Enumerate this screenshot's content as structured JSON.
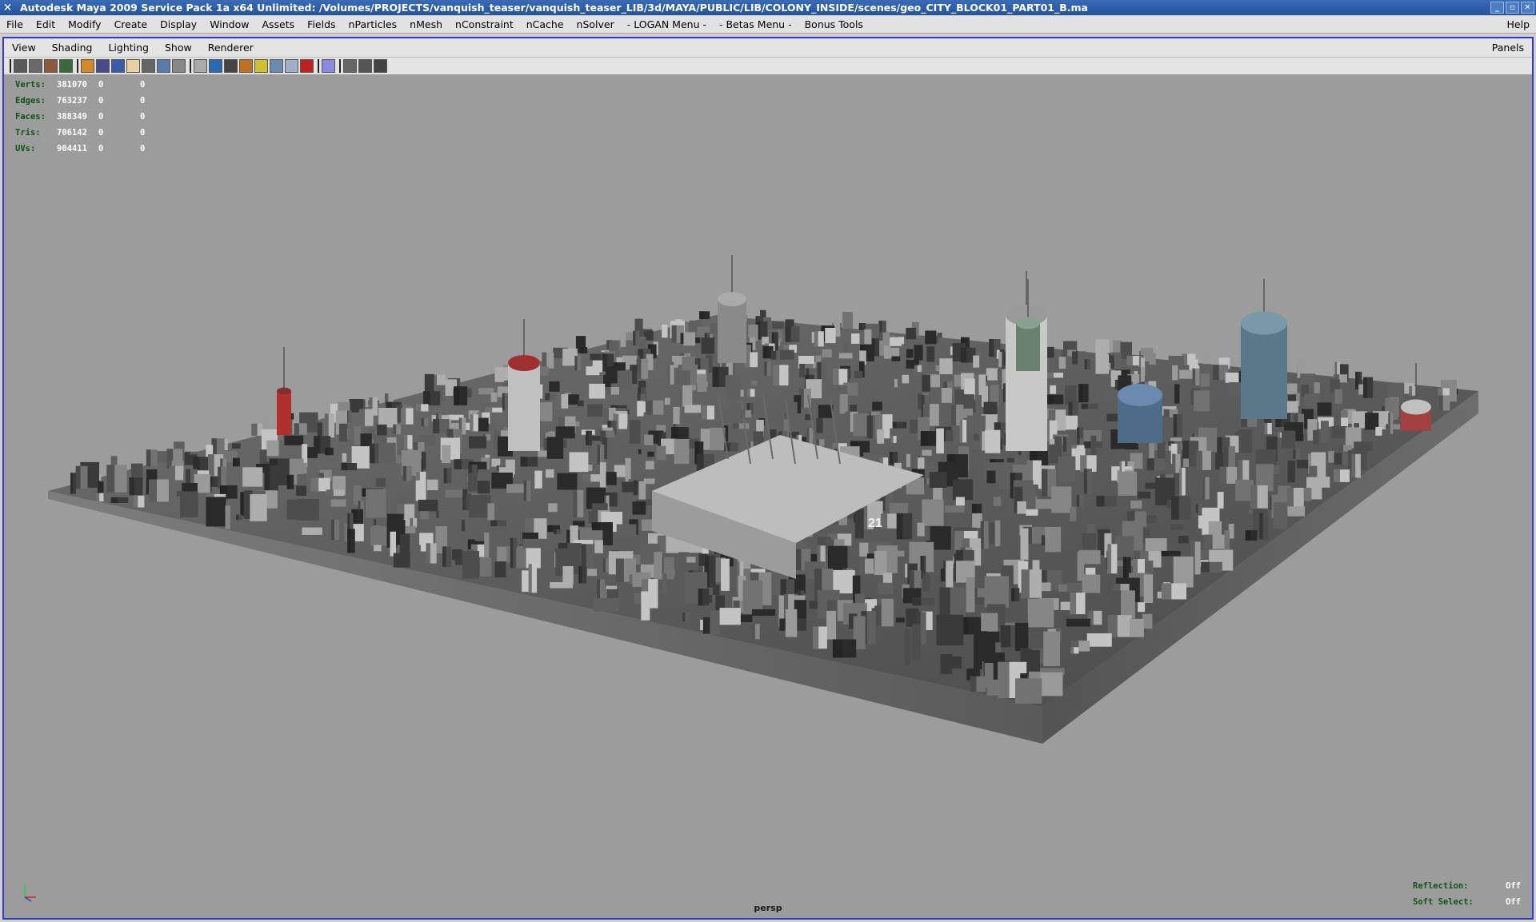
{
  "window": {
    "title": "Autodesk Maya 2009 Service Pack 1a x64 Unlimited: /Volumes/PROJECTS/vanquish_teaser/vanquish_teaser_LIB/3d/MAYA/PUBLIC/LIB/COLONY_INSIDE/scenes/geo_CITY_BLOCK01_PART01_B.ma",
    "app_icon": "maya-icon",
    "controls": {
      "minimize": "_",
      "maximize": "▫",
      "close": "✕"
    }
  },
  "main_menu": {
    "items": [
      "File",
      "Edit",
      "Modify",
      "Create",
      "Display",
      "Window",
      "Assets",
      "Fields",
      "nParticles",
      "nMesh",
      "nConstraint",
      "nCache",
      "nSolver",
      "- LOGAN Menu -",
      "- Betas Menu -",
      "Bonus Tools"
    ],
    "help": "Help"
  },
  "panel_menu": {
    "items": [
      "View",
      "Shading",
      "Lighting",
      "Show",
      "Renderer"
    ],
    "panels": "Panels"
  },
  "panel_toolbar": {
    "icons": [
      "camera-select-icon",
      "camera-attributes-icon",
      "bookmarks-icon",
      "image-plane-icon",
      "grid-icon",
      "film-gate-icon",
      "resolution-gate-icon",
      "gate-mask-icon",
      "field-chart-icon",
      "safe-action-icon",
      "safe-title-icon",
      "wireframe-icon",
      "smooth-shade-icon",
      "flat-shade-icon",
      "wireframe-on-shaded-icon",
      "default-light-icon",
      "textured-icon",
      "shadows-icon",
      "high-quality-icon",
      "isolate-select-icon",
      "xray-icon",
      "xray-joints-icon",
      "backface-culling-icon"
    ],
    "icon_colors": [
      "#5a5a5a",
      "#6a6a6a",
      "#8a5a3a",
      "#3a6a3a",
      "#d08a2a",
      "#4a4a8a",
      "#3a5aaa",
      "#e8d0a0",
      "#666",
      "#5a7aaa",
      "#888",
      "#aaa",
      "#2a6ab0",
      "#444",
      "#c07020",
      "#d0c030",
      "#6a8ab0",
      "#a0b0c8",
      "#c02020",
      "#8a8ae0",
      "#666",
      "#555",
      "#444"
    ]
  },
  "hud": {
    "rows": [
      {
        "label": "Verts:",
        "value": "381070",
        "sel": "0",
        "uv": "0"
      },
      {
        "label": "Edges:",
        "value": "763237",
        "sel": "0",
        "uv": "0"
      },
      {
        "label": "Faces:",
        "value": "388349",
        "sel": "0",
        "uv": "0"
      },
      {
        "label": "Tris:",
        "value": "706142",
        "sel": "0",
        "uv": "0"
      },
      {
        "label": "UVs:",
        "value": "904411",
        "sel": "0",
        "uv": "0"
      }
    ],
    "reflection_label": "Reflection:",
    "reflection_value": "Off",
    "soft_select_label": "Soft Select:",
    "soft_select_value": "Off"
  },
  "viewport": {
    "camera": "persp",
    "background_color": "#9c9c9c",
    "scene_label": "21"
  },
  "colors": {
    "titlebar": "#2a5aa8",
    "viewport_border": "#2a3ad8",
    "hud_label": "#0d5416"
  }
}
